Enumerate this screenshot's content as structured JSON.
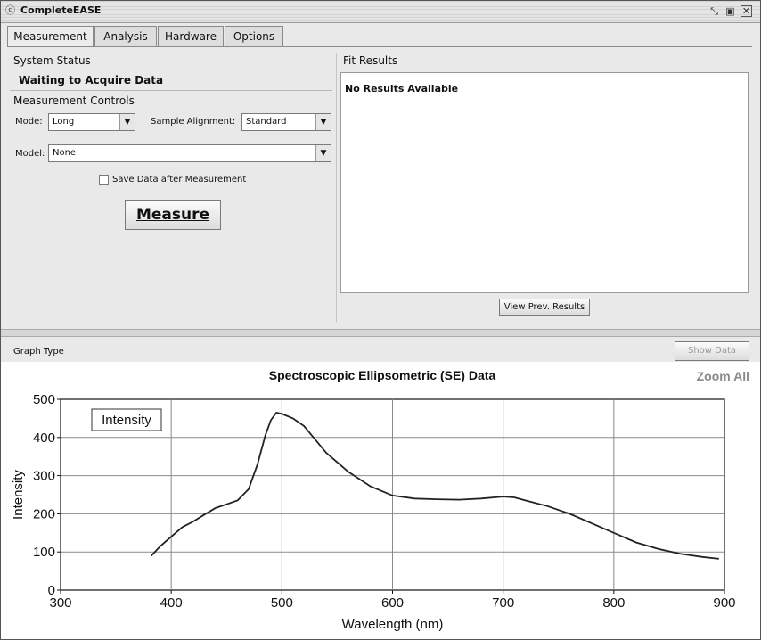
{
  "window": {
    "title": "CompleteEASE",
    "controls": [
      "restore-icon",
      "maximize-icon",
      "close-icon"
    ]
  },
  "tabs": [
    {
      "label": "Measurement",
      "active": true
    },
    {
      "label": "Analysis",
      "active": false
    },
    {
      "label": "Hardware",
      "active": false
    },
    {
      "label": "Options",
      "active": false
    }
  ],
  "system_status": {
    "heading": "System Status",
    "value": "Waiting to Acquire Data"
  },
  "measurement_controls": {
    "heading": "Measurement Controls",
    "mode": {
      "label": "Mode:",
      "value": "Long"
    },
    "sample_alignment": {
      "label": "Sample Alignment:",
      "value": "Standard"
    },
    "model": {
      "label": "Model:",
      "value": "None"
    },
    "save_checkbox": {
      "label": "Save Data after Measurement",
      "checked": false
    },
    "measure_button": "Measure"
  },
  "fit_results": {
    "heading": "Fit Results",
    "message": "No Results Available",
    "view_prev_button": "View Prev. Results"
  },
  "graph_bar": {
    "label": "Graph Type",
    "show_data_button": "Show Data"
  },
  "zoom_all": "Zoom All",
  "chart_data": {
    "type": "line",
    "title": "Spectroscopic Ellipsometric (SE) Data",
    "xlabel": "Wavelength (nm)",
    "ylabel": "Intensity",
    "xlim": [
      300,
      900
    ],
    "ylim": [
      0,
      500
    ],
    "xticks": [
      300,
      400,
      500,
      600,
      700,
      800,
      900
    ],
    "yticks": [
      0,
      100,
      200,
      300,
      400,
      500
    ],
    "grid": true,
    "legend": "top-left",
    "series": [
      {
        "name": "Intensity",
        "color": "#222222",
        "x": [
          382,
          390,
          400,
          410,
          420,
          430,
          440,
          450,
          460,
          470,
          478,
          485,
          490,
          495,
          500,
          510,
          520,
          530,
          540,
          560,
          580,
          600,
          620,
          640,
          660,
          680,
          700,
          710,
          720,
          740,
          760,
          780,
          800,
          820,
          840,
          860,
          880,
          895
        ],
        "y": [
          90,
          115,
          140,
          165,
          180,
          198,
          215,
          225,
          235,
          265,
          330,
          405,
          445,
          465,
          462,
          450,
          430,
          395,
          360,
          310,
          272,
          248,
          240,
          238,
          237,
          240,
          245,
          243,
          235,
          220,
          200,
          175,
          150,
          125,
          108,
          95,
          87,
          82
        ]
      }
    ]
  }
}
